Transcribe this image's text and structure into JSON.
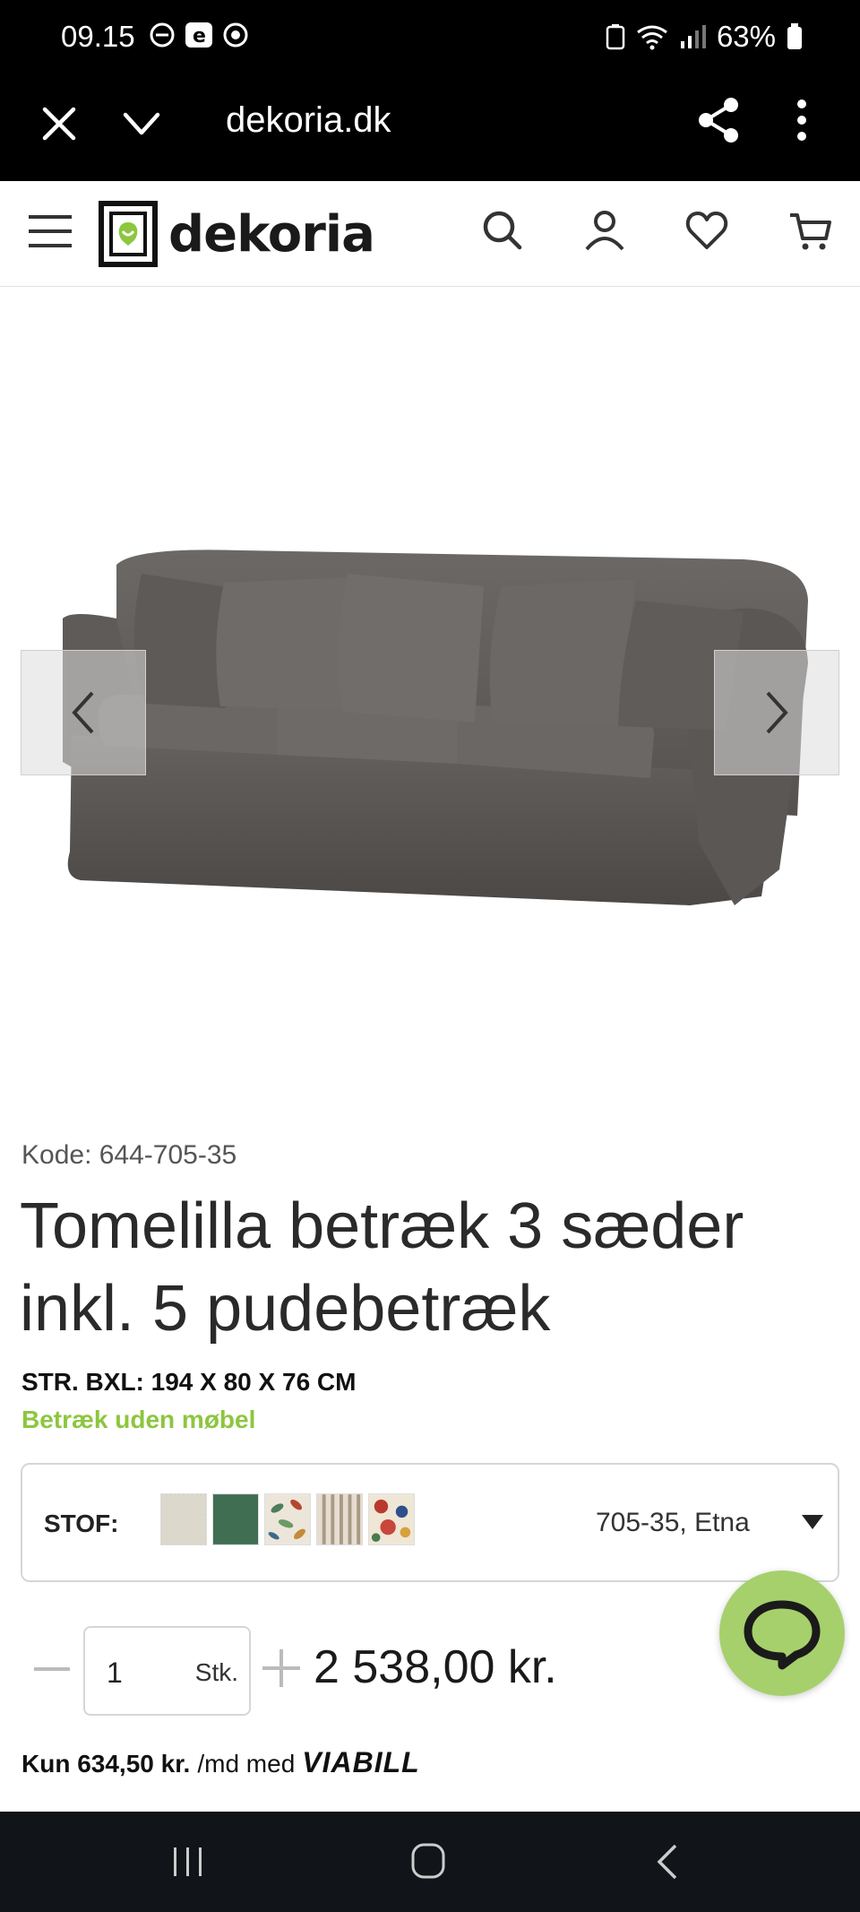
{
  "status_bar": {
    "time": "09.15",
    "battery": "63%"
  },
  "browser": {
    "url": "dekoria.dk"
  },
  "site": {
    "logo_text": "dekoria",
    "brand_color": "#8dc63f"
  },
  "product": {
    "code": "Kode: 644-705-35",
    "title": "Tomelilla betræk 3 sæder inkl. 5 pudebetræk",
    "size": "STR. BXL: 194 X 80 X 76 CM",
    "note": "Betræk uden møbel",
    "fabric_label": "STOF:",
    "fabric_value": "705-35, Etna",
    "quantity": "1",
    "quantity_unit": "Stk.",
    "price": "2 538,00 kr.",
    "installment_amount": "Kun 634,50 kr.",
    "installment_text": "/md med",
    "installment_provider": "VIABILL"
  },
  "swatches": [
    {
      "name": "swatch-beige",
      "color": "#dcd8cc"
    },
    {
      "name": "swatch-green",
      "color": "#3f6e53"
    },
    {
      "name": "swatch-leaves",
      "color": "#e8e2d6"
    },
    {
      "name": "swatch-stripes",
      "color": "#d8cfc0"
    },
    {
      "name": "swatch-floral",
      "color": "#b24a3a"
    }
  ]
}
